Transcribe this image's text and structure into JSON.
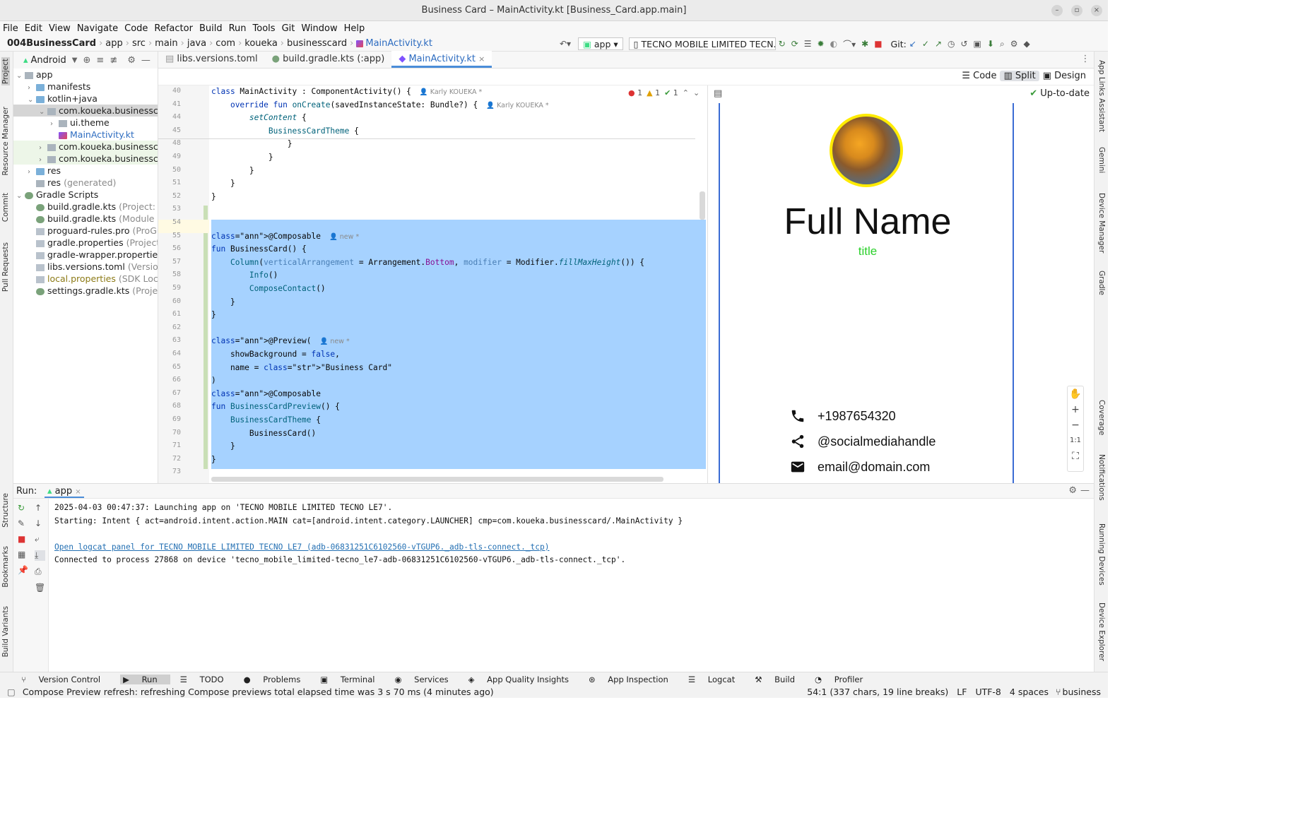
{
  "window": {
    "title": "Business Card – MainActivity.kt [Business_Card.app.main]"
  },
  "menu": [
    "File",
    "Edit",
    "View",
    "Navigate",
    "Code",
    "Refactor",
    "Build",
    "Run",
    "Tools",
    "Git",
    "Window",
    "Help"
  ],
  "breadcrumb": [
    "004BusinessCard",
    "app",
    "src",
    "main",
    "java",
    "com",
    "koueka",
    "businesscard",
    "MainActivity.kt"
  ],
  "toolbar": {
    "config": "app",
    "device": "TECNO MOBILE LIMITED TECN...",
    "git_label": "Git:"
  },
  "left_toolwindows": [
    "Project",
    "Resource Manager",
    "Commit",
    "Pull Requests",
    "Structure",
    "Bookmarks",
    "Build Variants"
  ],
  "right_toolwindows": [
    "App Links Assistant",
    "Gemini",
    "Device Manager",
    "Gradle",
    "Coverage",
    "Notifications",
    "Running Devices",
    "Device Explorer"
  ],
  "project": {
    "view": "Android",
    "tree": [
      {
        "label": "app",
        "hint": ""
      },
      {
        "label": "manifests",
        "hint": ""
      },
      {
        "label": "kotlin+java",
        "hint": ""
      },
      {
        "label": "com.koueka.businesscard",
        "hint": ""
      },
      {
        "label": "ui.theme",
        "hint": ""
      },
      {
        "label": "MainActivity.kt",
        "hint": ""
      },
      {
        "label": "com.koueka.businesscard",
        "hint": ""
      },
      {
        "label": "com.koueka.businesscard",
        "hint": ""
      },
      {
        "label": "res",
        "hint": ""
      },
      {
        "label": "res",
        "hint": "(generated)"
      },
      {
        "label": "Gradle Scripts",
        "hint": ""
      },
      {
        "label": "build.gradle.kts",
        "hint": "(Project: Bu"
      },
      {
        "label": "build.gradle.kts",
        "hint": "(Module :ap"
      },
      {
        "label": "proguard-rules.pro",
        "hint": "(ProGua"
      },
      {
        "label": "gradle.properties",
        "hint": "(Project P"
      },
      {
        "label": "gradle-wrapper.properties",
        "hint": ""
      },
      {
        "label": "libs.versions.toml",
        "hint": "(Version C"
      },
      {
        "label": "local.properties",
        "hint": "(SDK Locat"
      },
      {
        "label": "settings.gradle.kts",
        "hint": "(Project"
      }
    ]
  },
  "editor_tabs": [
    "libs.versions.toml",
    "build.gradle.kts (:app)",
    "MainActivity.kt"
  ],
  "view_modes": {
    "code": "Code",
    "split": "Split",
    "design": "Design",
    "status": "Up-to-date"
  },
  "inspections": {
    "errors": "1",
    "warnings": "1",
    "weak": "1"
  },
  "code_lines": [
    {
      "n": "40",
      "text": "class MainActivity : ComponentActivity() {",
      "author": "Karly KOUEKA *"
    },
    {
      "n": "41",
      "text": "    override fun onCreate(savedInstanceState: Bundle?) {",
      "author": "Karly KOUEKA *"
    },
    {
      "n": "44",
      "text": "        setContent {"
    },
    {
      "n": "45",
      "text": "            BusinessCardTheme {"
    },
    {
      "n": "48",
      "text": "                }"
    },
    {
      "n": "49",
      "text": "            }"
    },
    {
      "n": "50",
      "text": "        }"
    },
    {
      "n": "51",
      "text": "    }"
    },
    {
      "n": "52",
      "text": "}"
    },
    {
      "n": "53",
      "text": ""
    },
    {
      "n": "54",
      "text": ""
    },
    {
      "n": "55",
      "text": "@Composable",
      "author": "new *"
    },
    {
      "n": "56",
      "text": "fun BusinessCard() {"
    },
    {
      "n": "57",
      "text": "    Column(verticalArrangement = Arrangement.Bottom, modifier = Modifier.fillMaxHeight()) {"
    },
    {
      "n": "58",
      "text": "        Info()"
    },
    {
      "n": "59",
      "text": "        ComposeContact()"
    },
    {
      "n": "60",
      "text": "    }"
    },
    {
      "n": "61",
      "text": "}"
    },
    {
      "n": "62",
      "text": ""
    },
    {
      "n": "63",
      "text": "@Preview(",
      "author": "new *"
    },
    {
      "n": "64",
      "text": "    showBackground = false,"
    },
    {
      "n": "65",
      "text": "    name = \"Business Card\""
    },
    {
      "n": "66",
      "text": ")"
    },
    {
      "n": "67",
      "text": "@Composable"
    },
    {
      "n": "68",
      "text": "fun BusinessCardPreview() {"
    },
    {
      "n": "69",
      "text": "    BusinessCardTheme {"
    },
    {
      "n": "70",
      "text": "        BusinessCard()"
    },
    {
      "n": "71",
      "text": "    }"
    },
    {
      "n": "72",
      "text": "}"
    },
    {
      "n": "73",
      "text": ""
    }
  ],
  "preview": {
    "name": "Full Name",
    "title": "title",
    "phone": "+1987654320",
    "social": "@socialmediahandle",
    "email": "email@domain.com",
    "zoom_reset": "1:1"
  },
  "run": {
    "label": "Run:",
    "config": "app",
    "lines": [
      "2025-04-03 00:47:37: Launching app on 'TECNO MOBILE LIMITED TECNO LE7'.",
      "Starting: Intent { act=android.intent.action.MAIN cat=[android.intent.category.LAUNCHER] cmp=com.koueka.businesscard/.MainActivity }",
      "",
      "Open logcat panel for TECNO MOBILE LIMITED TECNO LE7 (adb-06831251C6102560-vTGUP6._adb-tls-connect._tcp)",
      "Connected to process 27868 on device 'tecno_mobile_limited-tecno_le7-adb-06831251C6102560-vTGUP6._adb-tls-connect._tcp'."
    ]
  },
  "bottom_tabs": [
    "Version Control",
    "Run",
    "TODO",
    "Problems",
    "Terminal",
    "Services",
    "App Quality Insights",
    "App Inspection",
    "Logcat",
    "Build",
    "Profiler"
  ],
  "status": {
    "message": "Compose Preview refresh: refreshing Compose previews total elapsed time was 3 s 70 ms (4 minutes ago)",
    "position": "54:1 (337 chars, 19 line breaks)",
    "line_sep": "LF",
    "encoding": "UTF-8",
    "indent": "4 spaces",
    "branch": "business"
  },
  "colors": {
    "accent": "#3b6cd4",
    "selection": "#a6d2ff",
    "title_green": "#2bd02b",
    "avatar_ring": "#ffeb00"
  }
}
